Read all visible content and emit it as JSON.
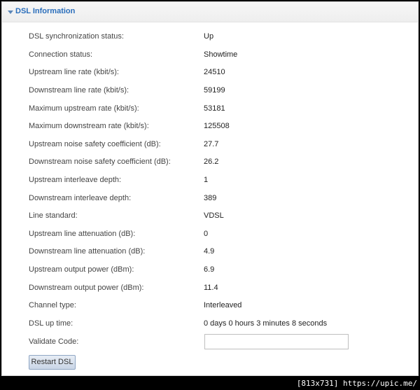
{
  "panel": {
    "title": "DSL Information"
  },
  "rows": [
    {
      "label": "DSL synchronization status:",
      "value": "Up"
    },
    {
      "label": "Connection status:",
      "value": "Showtime"
    },
    {
      "label": "Upstream line rate (kbit/s):",
      "value": "24510"
    },
    {
      "label": "Downstream line rate (kbit/s):",
      "value": "59199"
    },
    {
      "label": "Maximum upstream rate (kbit/s):",
      "value": "53181"
    },
    {
      "label": "Maximum downstream rate (kbit/s):",
      "value": "125508"
    },
    {
      "label": "Upstream noise safety coefficient (dB):",
      "value": "27.7"
    },
    {
      "label": "Downstream noise safety coefficient (dB):",
      "value": "26.2"
    },
    {
      "label": "Upstream interleave depth:",
      "value": "1"
    },
    {
      "label": "Downstream interleave depth:",
      "value": "389"
    },
    {
      "label": "Line standard:",
      "value": "VDSL"
    },
    {
      "label": "Upstream line attenuation (dB):",
      "value": "0"
    },
    {
      "label": "Downstream line attenuation (dB):",
      "value": "4.9"
    },
    {
      "label": "Upstream output power (dBm):",
      "value": "6.9"
    },
    {
      "label": "Downstream output power (dBm):",
      "value": "11.4"
    },
    {
      "label": "Channel type:",
      "value": "Interleaved"
    },
    {
      "label": "DSL up time:",
      "value": "0 days 0 hours 3 minutes 8 seconds"
    }
  ],
  "validate": {
    "label": "Validate Code:",
    "value": "",
    "placeholder": ""
  },
  "restart_button": {
    "label": "Restart DSL"
  },
  "watermark": {
    "text": "[813x731] https://upic.me/"
  },
  "colors": {
    "title": "#2a6ebb",
    "arrow": "#5b86b8",
    "button_border": "#8fa6c4"
  }
}
